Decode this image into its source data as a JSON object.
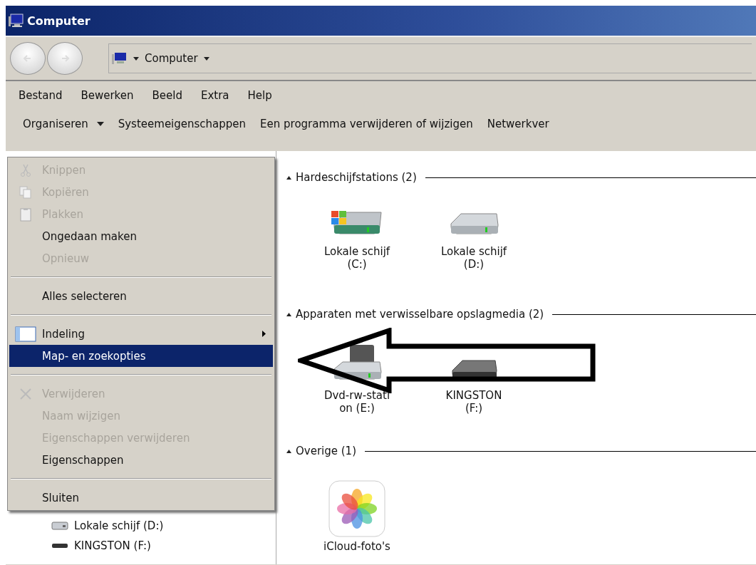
{
  "window": {
    "title": "Computer"
  },
  "address": {
    "crumb": "Computer"
  },
  "menubar": [
    {
      "label": "Bestand"
    },
    {
      "label": "Bewerken"
    },
    {
      "label": "Beeld"
    },
    {
      "label": "Extra"
    },
    {
      "label": "Help"
    }
  ],
  "commands": [
    {
      "label": "Organiseren",
      "dropdown": true
    },
    {
      "label": "Systeemeigenschappen",
      "dropdown": false
    },
    {
      "label": "Een programma verwijderen of wijzigen",
      "dropdown": false
    },
    {
      "label": "Netwerkver",
      "dropdown": false
    }
  ],
  "context_menu": {
    "groups": [
      [
        {
          "label": "Knippen",
          "disabled": true,
          "submenu": false,
          "selected": false
        },
        {
          "label": "Kopiëren",
          "disabled": true,
          "submenu": false,
          "selected": false
        },
        {
          "label": "Plakken",
          "disabled": true,
          "submenu": false,
          "selected": false
        },
        {
          "label": "Ongedaan maken",
          "disabled": false,
          "submenu": false,
          "selected": false
        },
        {
          "label": "Opnieuw",
          "disabled": true,
          "submenu": false,
          "selected": false
        }
      ],
      [
        {
          "label": "Alles selecteren",
          "disabled": false,
          "submenu": false,
          "selected": false
        }
      ],
      [
        {
          "label": "Indeling",
          "disabled": false,
          "submenu": true,
          "selected": false
        },
        {
          "label": "Map- en zoekopties",
          "disabled": false,
          "submenu": false,
          "selected": true
        }
      ],
      [
        {
          "label": "Verwijderen",
          "disabled": true,
          "submenu": false,
          "selected": false
        },
        {
          "label": "Naam wijzigen",
          "disabled": true,
          "submenu": false,
          "selected": false
        },
        {
          "label": "Eigenschappen verwijderen",
          "disabled": true,
          "submenu": false,
          "selected": false
        },
        {
          "label": "Eigenschappen",
          "disabled": false,
          "submenu": false,
          "selected": false
        }
      ],
      [
        {
          "label": "Sluiten",
          "disabled": false,
          "submenu": false,
          "selected": false
        }
      ]
    ]
  },
  "tree": [
    {
      "label": "Lokale schijf (D:)",
      "kind": "drive"
    },
    {
      "label": "KINGSTON (F:)",
      "kind": "usb"
    }
  ],
  "sections": [
    {
      "title": "Hardeschijfstations (2)",
      "expanded": true,
      "items": [
        {
          "lines": [
            "Lokale schijf",
            "(C:)"
          ],
          "kind": "system"
        },
        {
          "lines": [
            "Lokale schijf",
            "(D:)"
          ],
          "kind": "drive"
        }
      ]
    },
    {
      "title": "Apparaten met verwisselbare opslagmedia (2)",
      "expanded": true,
      "items": [
        {
          "lines": [
            "Dvd-rw-stati",
            "on (E:)"
          ],
          "kind": "dvd"
        },
        {
          "lines": [
            "KINGSTON",
            "(F:)"
          ],
          "kind": "usb"
        }
      ]
    },
    {
      "title": "Overige (1)",
      "expanded": true,
      "items": [
        {
          "lines": [
            "iCloud-foto's"
          ],
          "kind": "photos"
        }
      ]
    }
  ]
}
